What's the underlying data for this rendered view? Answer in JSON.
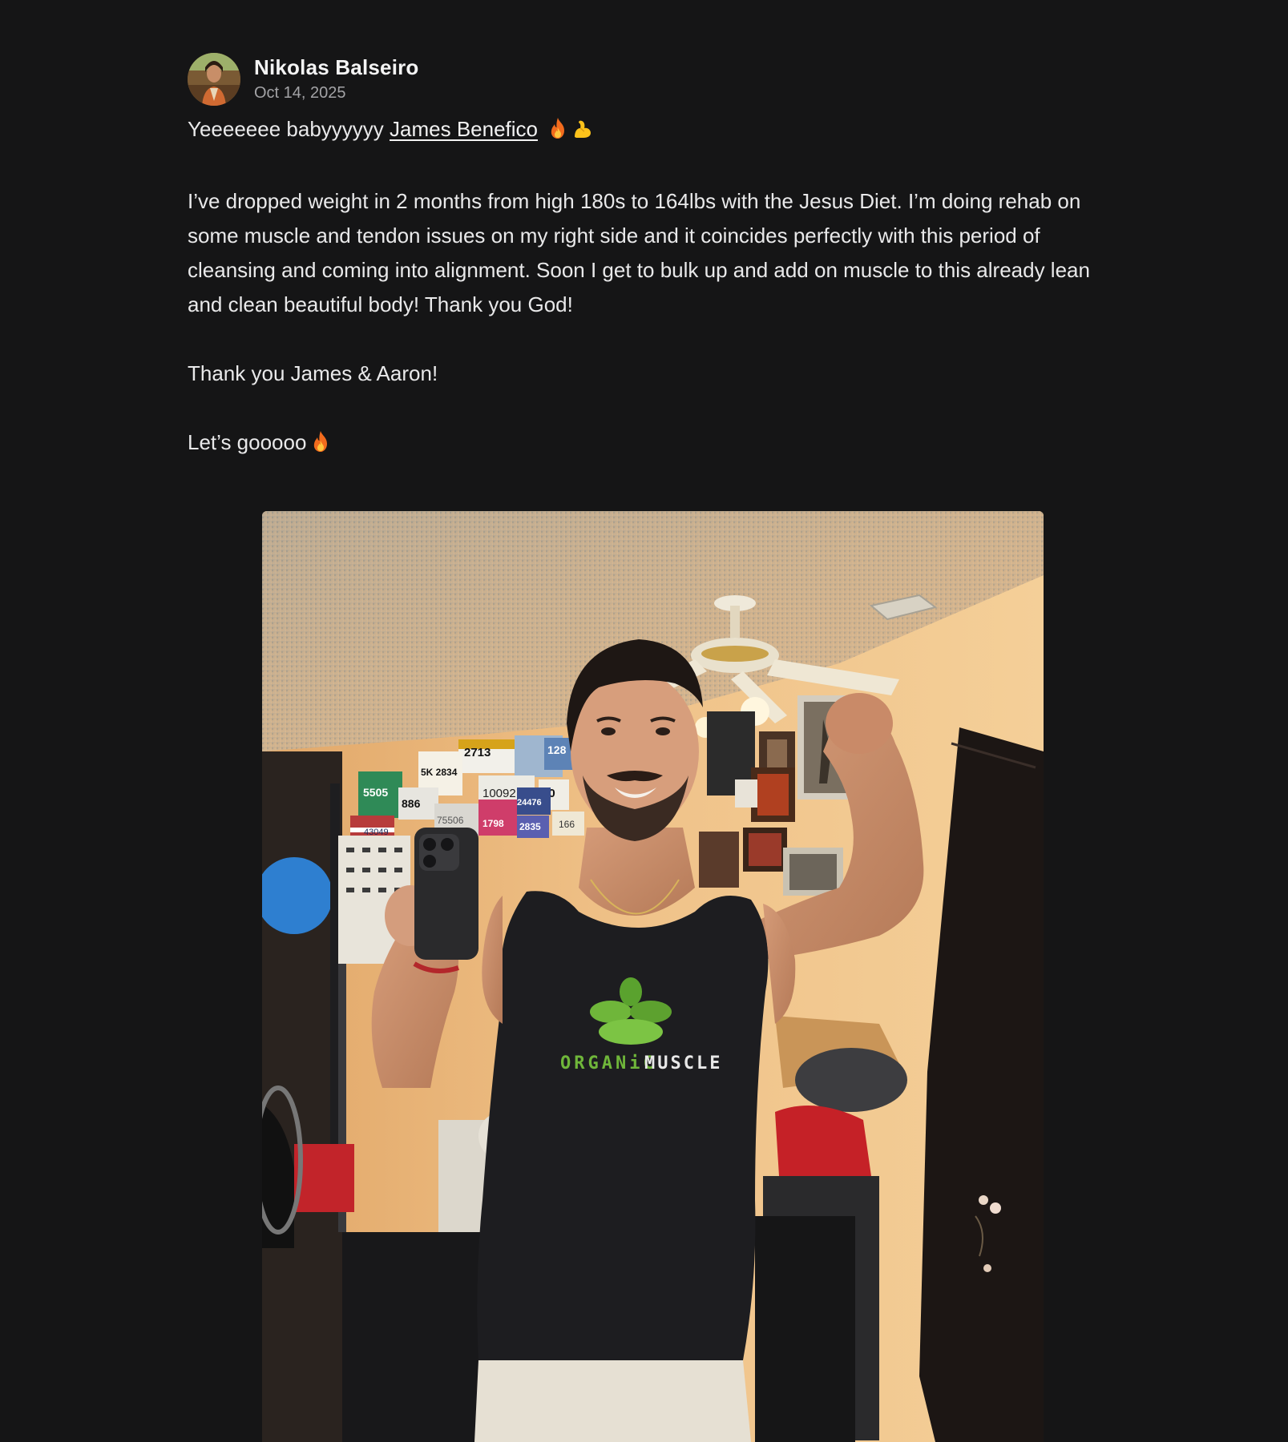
{
  "post": {
    "author": {
      "name": "Nikolas Balseiro",
      "avatar_icon": "avatar-photo"
    },
    "date": "Oct 14, 2025",
    "line1_text": "Yeeeeeee babyyyyyy",
    "mention": "James Benefico",
    "line1_emojis": [
      "fire-icon",
      "flexed-biceps-icon"
    ],
    "paragraph1": "I’ve dropped weight in 2 months from high 180s to 164lbs with the Jesus Diet. I’m doing rehab on some muscle and tendon issues on my right side and it coincides perfectly with this period of cleansing and coming into alignment. Soon I get to bulk up and add on muscle to this already lean and clean beautiful body! Thank you God!",
    "paragraph2": "Thank you James & Aaron!",
    "paragraph3": "Let’s gooooo",
    "paragraph3_emoji": "fire-icon"
  },
  "photo": {
    "description_icon": "mirror-selfie-photo",
    "shirt_brand_left": "ORGANiC",
    "shirt_brand_right": "MUSCLE",
    "race_bibs": [
      "2713",
      "5K 2834",
      "128",
      "5505",
      "10092",
      "50",
      "886",
      "24476",
      "75506",
      "1798",
      "2835",
      "166",
      "43049"
    ]
  },
  "colors": {
    "background": "#151516",
    "text": "#e9e9ea",
    "muted": "#a3a3a6",
    "shirt_green": "#6fb63a"
  }
}
